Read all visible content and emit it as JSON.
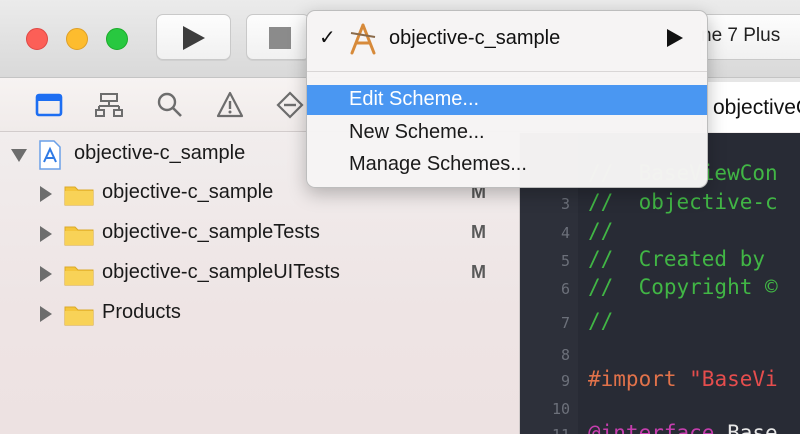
{
  "toolbar": {
    "scheme_target_partial": "ne 7 Plus"
  },
  "navigator_icons": [
    "folder-icon",
    "hierarchy-icon",
    "search-icon",
    "warning-icon",
    "test-diamond-icon"
  ],
  "tree": {
    "project": {
      "label": "objective-c_sample",
      "icon": "xcode-project-icon"
    },
    "items": [
      {
        "label": "objective-c_sample",
        "badge": "M"
      },
      {
        "label": "objective-c_sampleTests",
        "badge": "M"
      },
      {
        "label": "objective-c_sampleUITests",
        "badge": "M"
      },
      {
        "label": "Products",
        "badge": ""
      }
    ]
  },
  "editor": {
    "tab_label": "objectiveC",
    "lines": [
      {
        "num": "",
        "text": "//  BaseViewCon"
      },
      {
        "num": "3",
        "text": "//  objective-c"
      },
      {
        "num": "4",
        "text": "//"
      },
      {
        "num": "5",
        "text": "//  Created by"
      },
      {
        "num": "6",
        "text": "//  Copyright ©"
      },
      {
        "num": "7",
        "text": "//"
      },
      {
        "num": "8",
        "text": ""
      },
      {
        "num": "9",
        "directive": "#import",
        "string": " \"BaseVi"
      },
      {
        "num": "10",
        "text": ""
      },
      {
        "num": "11",
        "keyword": "@interface",
        "plain": " Base"
      }
    ]
  },
  "scheme_menu": {
    "checked_scheme": "objective-c_sample",
    "items": [
      "Edit Scheme...",
      "New Scheme...",
      "Manage Schemes..."
    ],
    "highlighted_index": 0,
    "highlight_color": "#4a97f2"
  },
  "colors": {
    "close": "#fc5f57",
    "minimize": "#fdbc2e",
    "maximize": "#28c840",
    "comment": "#41b645",
    "directive": "#e1724a",
    "keyword": "#c53eae",
    "string": "#e64d4d"
  }
}
